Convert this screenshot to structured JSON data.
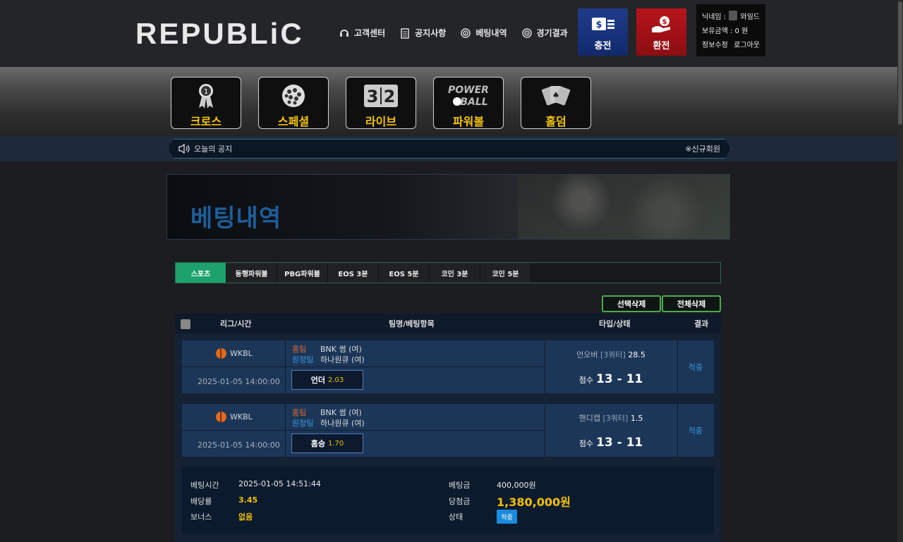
{
  "header": {
    "logo": "REPUBLiC",
    "nav": [
      {
        "label": "고객센터",
        "icon": "headset-icon"
      },
      {
        "label": "공지사항",
        "icon": "clipboard-icon"
      },
      {
        "label": "베팅내역",
        "icon": "target-icon"
      },
      {
        "label": "경기결과",
        "icon": "target-icon"
      }
    ],
    "charge_label": "충전",
    "exchange_label": "환전",
    "user": {
      "nickname_label": "닉네임 :",
      "nickname": "와일드",
      "balance_label": "보유금액 : 0 원",
      "edit_label": "정보수정",
      "logout_label": "로그아웃"
    }
  },
  "games": [
    {
      "label": "크로스",
      "icon": "medal-icon"
    },
    {
      "label": "스페셜",
      "icon": "ball-icon"
    },
    {
      "label": "라이브",
      "icon": "scoreboard-icon"
    },
    {
      "label": "파워볼",
      "icon": "powerball-icon"
    },
    {
      "label": "홀덤",
      "icon": "cards-icon"
    }
  ],
  "notice": {
    "label": "오늘의 공지",
    "right": "※신규회원"
  },
  "hero_title": "베팅내역",
  "tabs": [
    "스포츠",
    "동행파워볼",
    "PBG파워볼",
    "EOS 3분",
    "EOS 5분",
    "코인 3분",
    "코인 5분"
  ],
  "buttons": {
    "select_delete": "선택삭제",
    "all_delete": "전체삭제"
  },
  "table": {
    "headers": {
      "league_time": "리그/시간",
      "team_bet": "팀명/베팅항목",
      "type_status": "타입/상태",
      "result": "결과"
    },
    "bets": [
      {
        "league": "WKBL",
        "date": "2025-01-05 14:00:00",
        "home_label": "홈팀",
        "home": "BNK 썸 (여)",
        "away_label": "원정팀",
        "away": "하나원큐 (여)",
        "pick": "언더",
        "odds": "2.03",
        "type": "언오버",
        "quarter": "[3쿼터]",
        "line": "28.5",
        "score_label": "점수",
        "score": "13 - 11",
        "result": "적중"
      },
      {
        "league": "WKBL",
        "date": "2025-01-05 14:00:00",
        "home_label": "홈팀",
        "home": "BNK 썸 (여)",
        "away_label": "원정팀",
        "away": "하나원큐 (여)",
        "pick": "홈승",
        "odds": "1.70",
        "type": "핸디캡",
        "quarter": "[3쿼터]",
        "line": "1.5",
        "score_label": "점수",
        "score": "13 - 11",
        "result": "적중"
      }
    ]
  },
  "summary": {
    "bet_time_label": "베팅시간",
    "bet_time": "2025-01-05 14:51:44",
    "odds_label": "배당률",
    "odds": "3.45",
    "bonus_label": "보너스",
    "bonus": "없음",
    "bet_amount_label": "베팅금",
    "bet_amount": "400,000원",
    "win_amount_label": "당첨금",
    "win_amount": "1,380,000원",
    "status_label": "상태",
    "status": "적중"
  }
}
